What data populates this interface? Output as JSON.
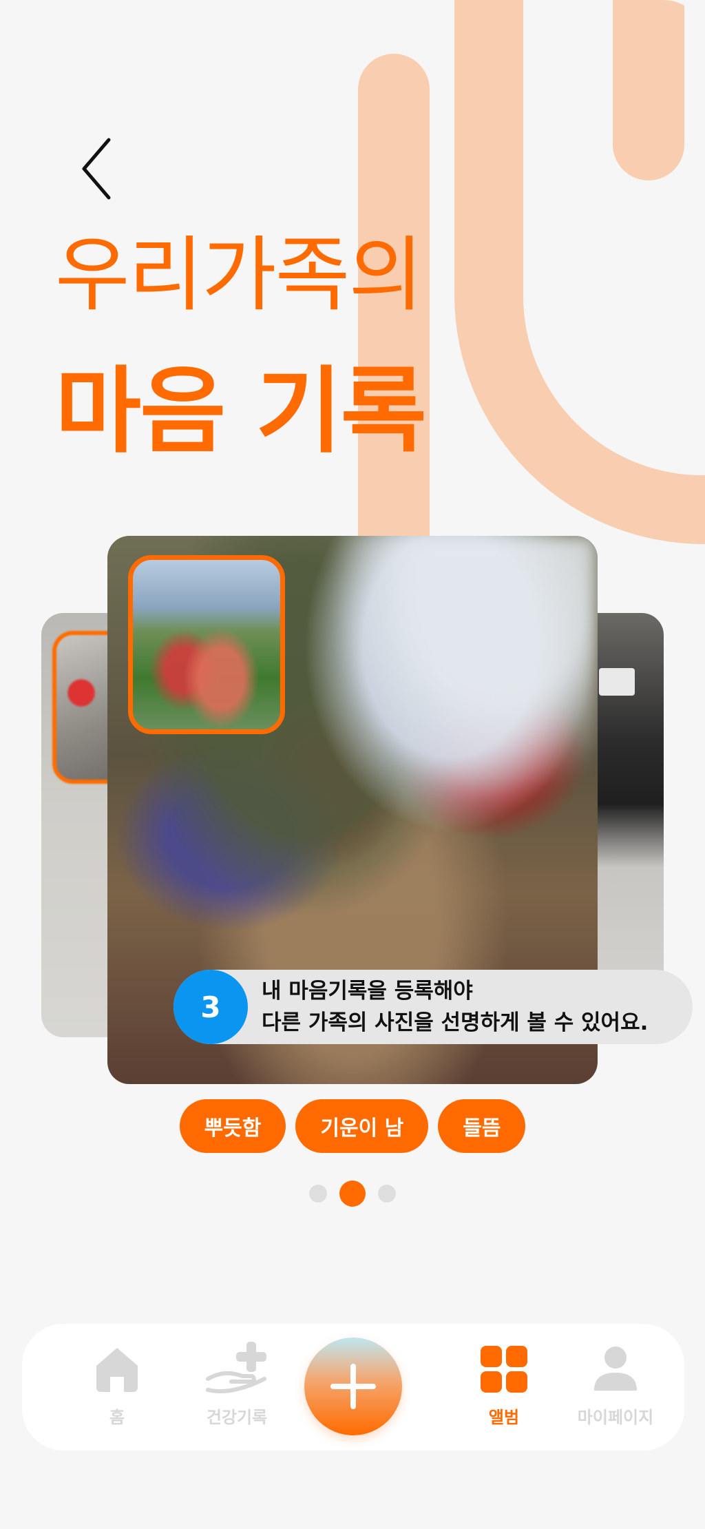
{
  "header": {
    "back_icon": "chevron-left-icon",
    "title_line1": "우리가족의",
    "title_line2": "마음 기록"
  },
  "guide": {
    "step": "3",
    "line1": "내 마음기록을 등록해야",
    "line2": "다른 가족의 사진을 선명하게 볼 수 있어요."
  },
  "tags": [
    "뿌듯함",
    "기운이 남",
    "들뜸"
  ],
  "pagination": {
    "total": 3,
    "active_index": 1
  },
  "bottom_nav": {
    "items": [
      {
        "label": "홈",
        "icon": "home-icon",
        "active": false
      },
      {
        "label": "건강기록",
        "icon": "health-record-icon",
        "active": false
      },
      {
        "label": "",
        "icon": "add-icon",
        "active": false
      },
      {
        "label": "앨범",
        "icon": "album-grid-icon",
        "active": true
      },
      {
        "label": "마이페이지",
        "icon": "person-icon",
        "active": false
      }
    ]
  },
  "colors": {
    "accent": "#ff6b00",
    "accent_light": "#f9ceb0",
    "background": "#f6f6f6",
    "guide_step": "#0a95f0",
    "inactive": "#d7d7d7"
  }
}
